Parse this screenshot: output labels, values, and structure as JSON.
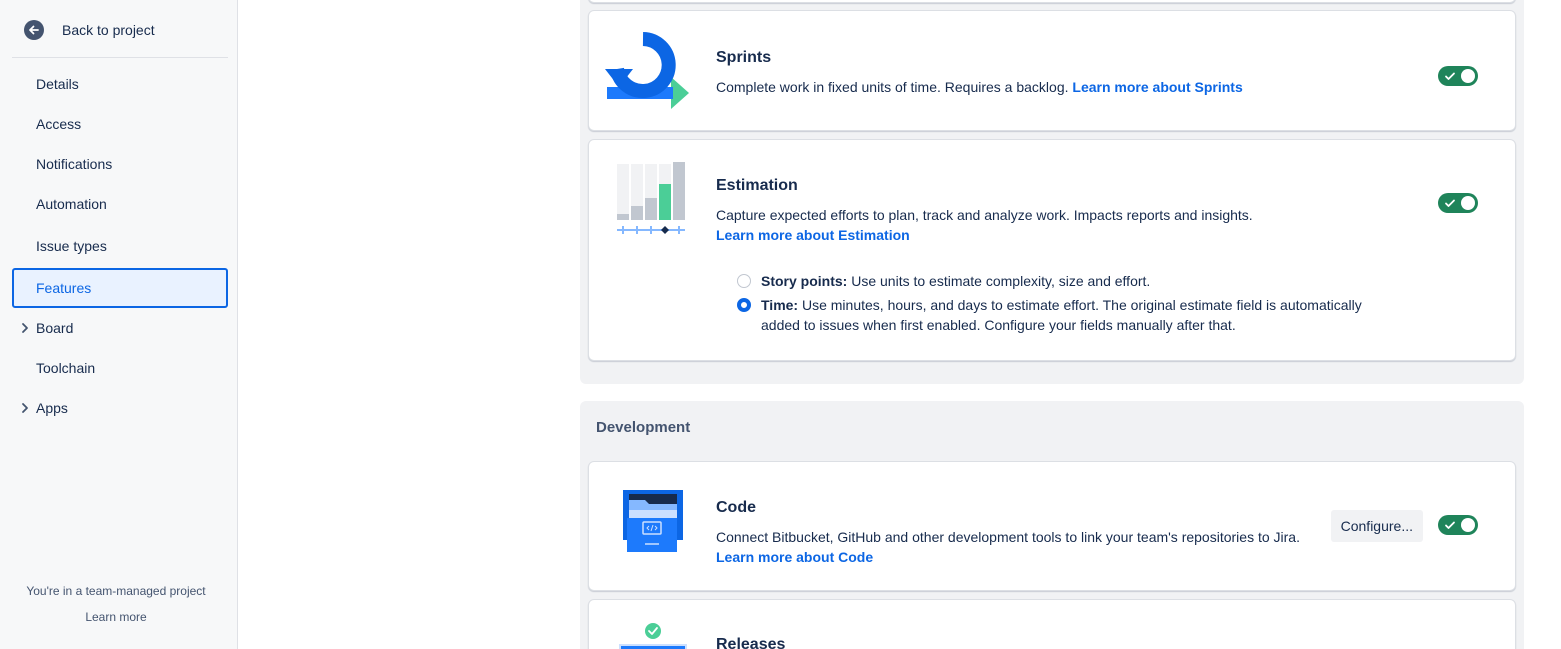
{
  "sidebar": {
    "back_label": "Back to project",
    "items": [
      {
        "label": "Details"
      },
      {
        "label": "Access"
      },
      {
        "label": "Notifications"
      },
      {
        "label": "Automation"
      },
      {
        "label": "Issue types"
      },
      {
        "label": "Features",
        "active": true
      },
      {
        "label": "Board",
        "expandable": true
      },
      {
        "label": "Toolchain"
      },
      {
        "label": "Apps",
        "expandable": true
      }
    ],
    "footer_text": "You're in a team-managed project",
    "footer_link": "Learn more"
  },
  "features": {
    "sprints": {
      "title": "Sprints",
      "description": "Complete work in fixed units of time. Requires a backlog.",
      "link": "Learn more about Sprints",
      "enabled": true
    },
    "estimation": {
      "title": "Estimation",
      "description": "Capture expected efforts to plan, track and analyze work. Impacts reports and insights.",
      "link": "Learn more about Estimation",
      "enabled": true,
      "options": [
        {
          "label": "Story points:",
          "text": "Use units to estimate complexity, size and effort.",
          "selected": false
        },
        {
          "label": "Time:",
          "text": "Use minutes, hours, and days to estimate effort. The original estimate field is automatically added to issues when first enabled. Configure your fields manually after that.",
          "selected": true
        }
      ]
    }
  },
  "development": {
    "heading": "Development",
    "code": {
      "title": "Code",
      "description": "Connect Bitbucket, GitHub and other development tools to link your team's repositories to Jira.",
      "link": "Learn more about Code",
      "configure_label": "Configure...",
      "enabled": true
    },
    "releases": {
      "title": "Releases"
    }
  },
  "colors": {
    "toggle_on": "#1f845a",
    "link": "#0c66e4",
    "active_nav_bg": "#e9f2ff"
  }
}
